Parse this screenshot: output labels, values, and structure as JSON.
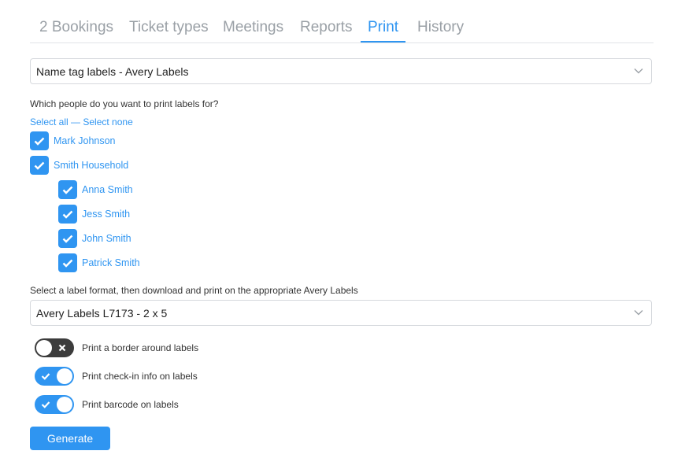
{
  "tabs": [
    {
      "label": "2 Bookings"
    },
    {
      "label": "Ticket types"
    },
    {
      "label": "Meetings"
    },
    {
      "label": "Reports"
    },
    {
      "label": "Print",
      "active": true
    },
    {
      "label": "History"
    }
  ],
  "label_type_select": {
    "value": "Name tag labels - Avery Labels"
  },
  "people_question": "Which people do you want to print labels for?",
  "selection_links": {
    "select_all": "Select all",
    "separator": " — ",
    "select_none": "Select none"
  },
  "people": [
    {
      "name": "Mark Johnson",
      "checked": true
    },
    {
      "name": "Smith Household",
      "checked": true
    },
    {
      "name": "Anna Smith",
      "checked": true
    },
    {
      "name": "Jess Smith",
      "checked": true
    },
    {
      "name": "John Smith",
      "checked": true
    },
    {
      "name": "Patrick Smith",
      "checked": true
    }
  ],
  "format_question": "Select a label format, then download and print on the appropriate Avery Labels",
  "format_select": {
    "value": "Avery Labels L7173 - 2 x 5"
  },
  "options": [
    {
      "label": "Print a border around labels",
      "enabled": false
    },
    {
      "label": "Print check-in info on labels",
      "enabled": true
    },
    {
      "label": "Print barcode on labels",
      "enabled": true
    }
  ],
  "generate_button": {
    "label": "Generate"
  },
  "colors": {
    "accent": "#2f95f1",
    "toggle_off": "#3c3c3c",
    "muted_tab": "#9aa0a6"
  }
}
